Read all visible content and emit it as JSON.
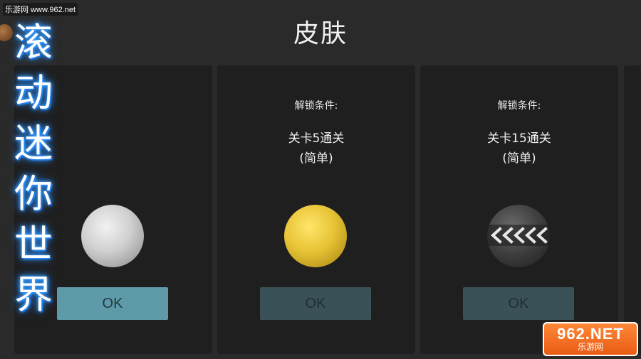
{
  "header": {
    "title": "皮肤"
  },
  "watermark": {
    "site": "乐游网 www.962.net"
  },
  "side_title": {
    "chars": [
      "滚",
      "动",
      "迷",
      "你",
      "世",
      "界"
    ]
  },
  "cards": [
    {
      "ball": "white-ball",
      "button_label": "OK",
      "button_state": "active"
    },
    {
      "unlock_title": "解锁条件:",
      "unlock_line1": "关卡5通关",
      "unlock_line2": "(简单)",
      "ball": "yellow-ball",
      "button_label": "OK",
      "button_state": "locked"
    },
    {
      "unlock_title": "解锁条件:",
      "unlock_line1": "关卡15通关",
      "unlock_line2": "(简单)",
      "ball": "chevron-ball",
      "button_label": "OK",
      "button_state": "locked"
    }
  ],
  "logo": {
    "main": "962.NET",
    "sub": "乐游网"
  },
  "colors": {
    "active_button": "#5f9aa8",
    "locked_button": "#3a5257",
    "card_bg": "#1f1f1f",
    "glow": "#3aa0ff"
  }
}
